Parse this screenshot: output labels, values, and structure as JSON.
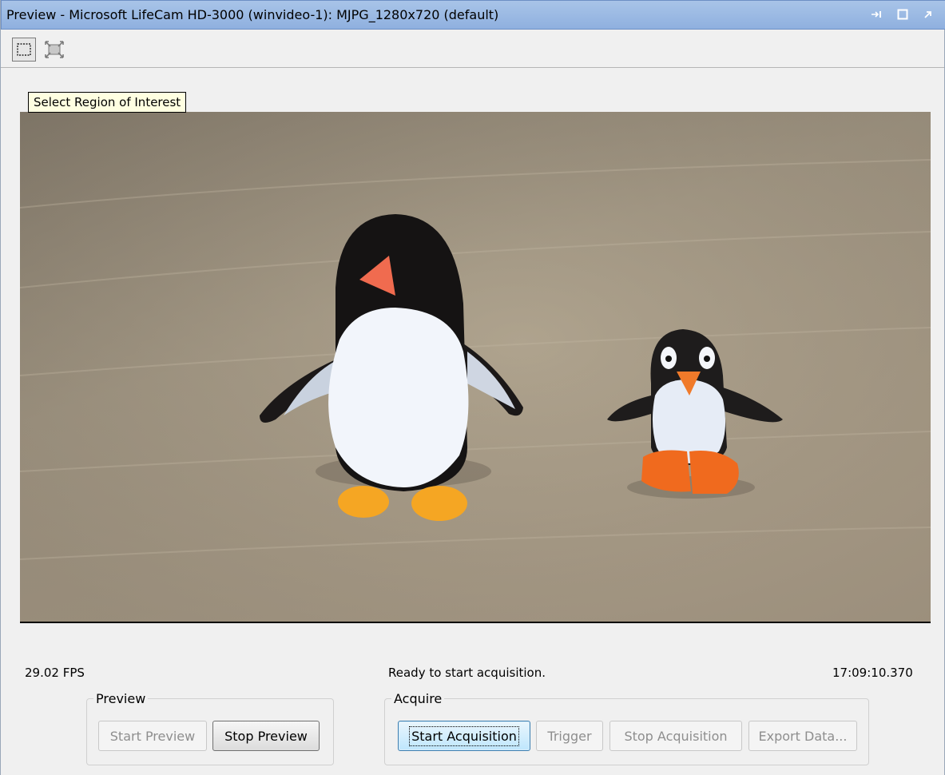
{
  "window": {
    "title": "Preview - Microsoft LifeCam HD-3000 (winvideo-1): MJPG_1280x720 (default)",
    "controls": [
      "pin-icon",
      "maximize-icon",
      "undock-icon"
    ]
  },
  "toolbar": {
    "tools": [
      "select-roi-icon",
      "fit-to-window-icon"
    ],
    "tooltip": "Select Region of Interest"
  },
  "statusbar": {
    "fps": "29.02 FPS",
    "message": "Ready to start acquisition.",
    "time": "17:09:10.370"
  },
  "preview_group": {
    "label": "Preview",
    "start_label": "Start Preview",
    "stop_label": "Stop Preview"
  },
  "acquire_group": {
    "label": "Acquire",
    "start_label": "Start Acquisition",
    "trigger_label": "Trigger",
    "stop_label": "Stop Acquisition",
    "export_label": "Export Data..."
  },
  "colors": {
    "titlebar": "#8fb0df",
    "tooltip_bg": "#ffffe1",
    "focused_button": "#bee6fd"
  }
}
